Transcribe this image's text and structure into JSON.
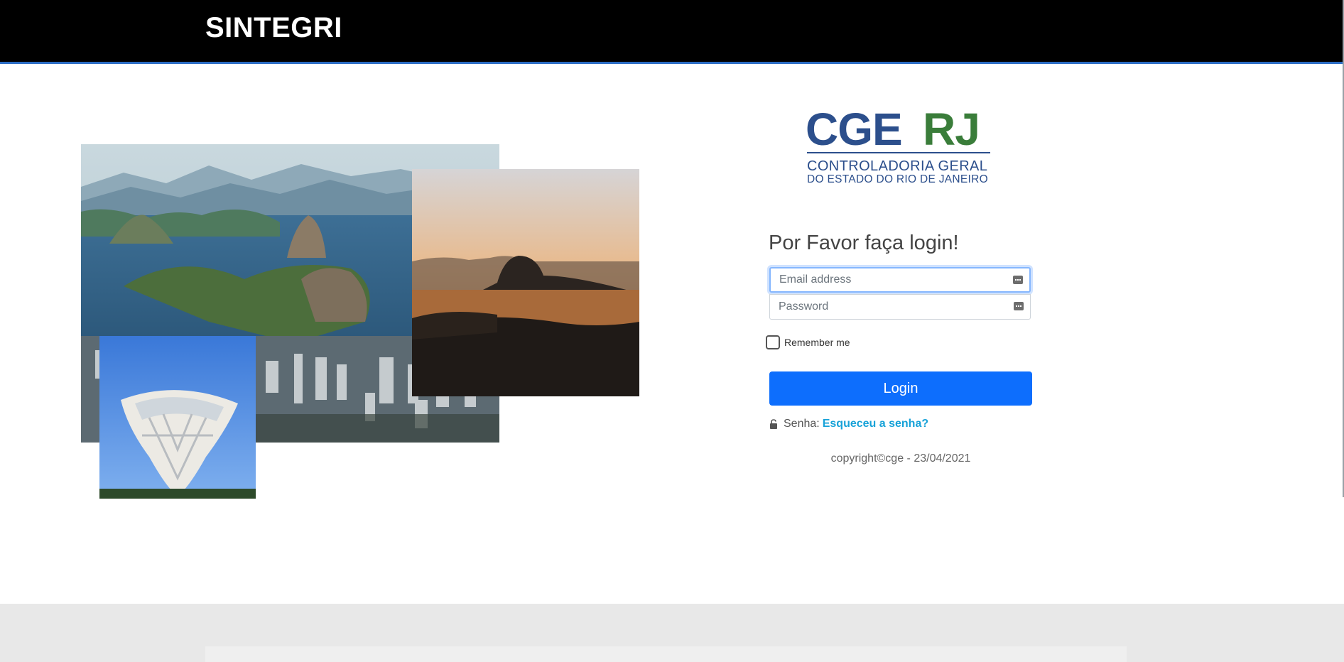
{
  "header": {
    "brand": "SINTEGRI"
  },
  "logo": {
    "part1": "CGE",
    "part2": "RJ",
    "line1": "CONTROLADORIA GERAL",
    "line2": "DO ESTADO DO RIO DE JANEIRO"
  },
  "login": {
    "heading": "Por Favor faça login!",
    "email_placeholder": "Email address",
    "password_placeholder": "Password",
    "remember_label": "Remember me",
    "submit_label": "Login",
    "forgot_prefix": "Senha:",
    "forgot_link": "Esqueceu a senha?",
    "copyright": "copyright©cge - 23/04/2021"
  },
  "colors": {
    "header_bg": "#000000",
    "primary": "#0d6efd",
    "logo_blue": "#2c4f8c",
    "logo_green": "#3a7d3a",
    "link": "#17a2d8"
  }
}
